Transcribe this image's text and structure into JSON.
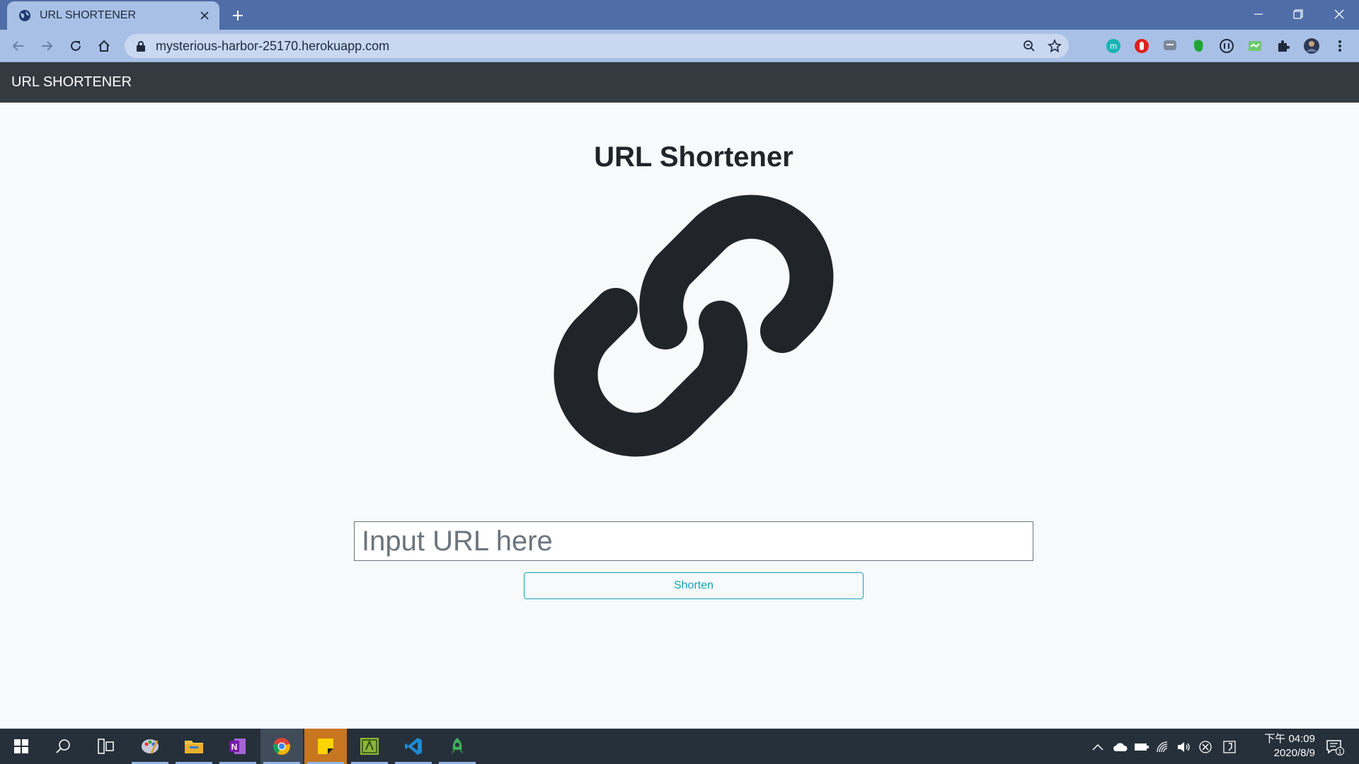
{
  "browser": {
    "tab_title": "URL SHORTENER",
    "url": "mysterious-harbor-25170.herokuapp.com",
    "icons": [
      "back-icon",
      "forward-icon",
      "reload-icon",
      "home-icon",
      "zoom-icon",
      "bookmark-star-icon",
      "extensions-icon",
      "profile-avatar",
      "menu-icon"
    ],
    "extensions": [
      "ext-m",
      "ext-red",
      "ext-chat",
      "ext-evernote",
      "ext-circle",
      "ext-green",
      "ext-puzzle"
    ]
  },
  "page": {
    "brand": "URL SHORTENER",
    "title": "URL Shortener",
    "graphic": "link-icon",
    "input_placeholder": "Input URL here",
    "input_value": "",
    "button_label": "Shorten",
    "accent_color": "#17a2b8",
    "navbar_color": "#343a40"
  },
  "taskbar": {
    "apps": [
      "start-icon",
      "search-icon",
      "task-view-icon",
      "paint-icon",
      "file-explorer-icon",
      "onenote-icon",
      "chrome-icon",
      "sticky-notes-icon",
      "app-green-icon",
      "vscode-icon",
      "app-rocket-icon"
    ],
    "clock_time": "下午 04:09",
    "clock_date": "2020/8/9",
    "notification_count": "1"
  }
}
